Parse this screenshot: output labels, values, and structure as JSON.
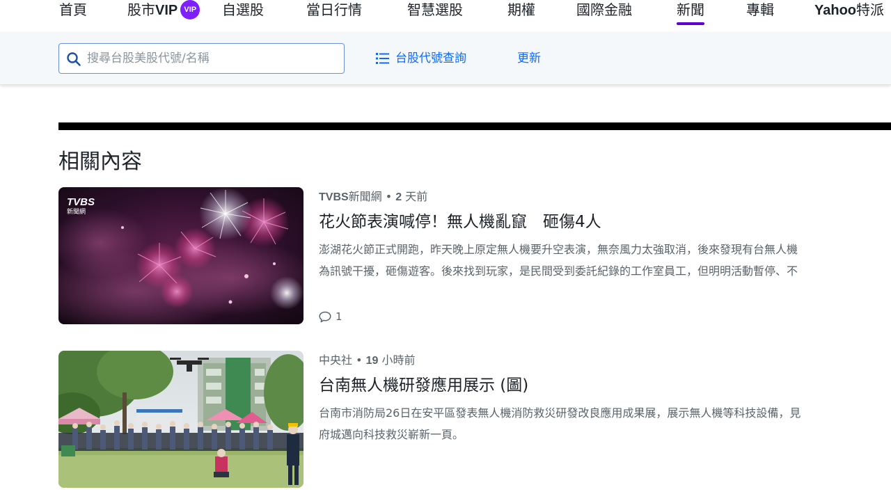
{
  "nav": {
    "items": [
      {
        "label": "首頁"
      },
      {
        "label": "股市",
        "bold_suffix": "VIP",
        "badge": "VIP"
      },
      {
        "label": "自選股"
      },
      {
        "label": "當日行情"
      },
      {
        "label": "智慧選股"
      },
      {
        "label": "期權"
      },
      {
        "label": "國際金融"
      },
      {
        "label": "新聞",
        "active": true
      },
      {
        "label": "專輯"
      },
      {
        "label": "特派",
        "bold_prefix": "Yahoo"
      }
    ]
  },
  "search": {
    "placeholder": "搜尋台股美股代號/名稱",
    "lookup_label": "台股代號查詢",
    "update_label": "更新"
  },
  "section": {
    "title": "相關內容"
  },
  "articles": [
    {
      "source": "TVBS",
      "source_suffix": "新聞網",
      "time_number": "2",
      "time_unit": "天前",
      "headline": "花火節表演喊停！無人機亂竄　砸傷4人",
      "summary_line1": "澎湖花火節正式開跑，昨天晚上原定無人機要升空表演，無奈風力太強取消，後來發現有台無人機",
      "summary_line2": "為訊號干擾，砸傷遊客。後來找到玩家，是民間受到委託紀錄的工作室員工，但明明活動暫停、不",
      "comment_count": "1",
      "thumb_logo_top": "TVBS",
      "thumb_logo_bottom": "新聞網"
    },
    {
      "source": "中央社",
      "time_number": "19",
      "time_unit": "小時前",
      "headline": "台南無人機研發應用展示 (圖)",
      "summary_line1": "台南市消防局26日在安平區發表無人機消防救災研發改良應用成果展，展示無人機等科技設備，見",
      "summary_line2": "府城邁向科技救災嶄新一頁。"
    }
  ],
  "colors": {
    "accent_purple": "#6001d2",
    "link_blue": "#0f69ff",
    "vip_purple": "#7e1fff"
  }
}
